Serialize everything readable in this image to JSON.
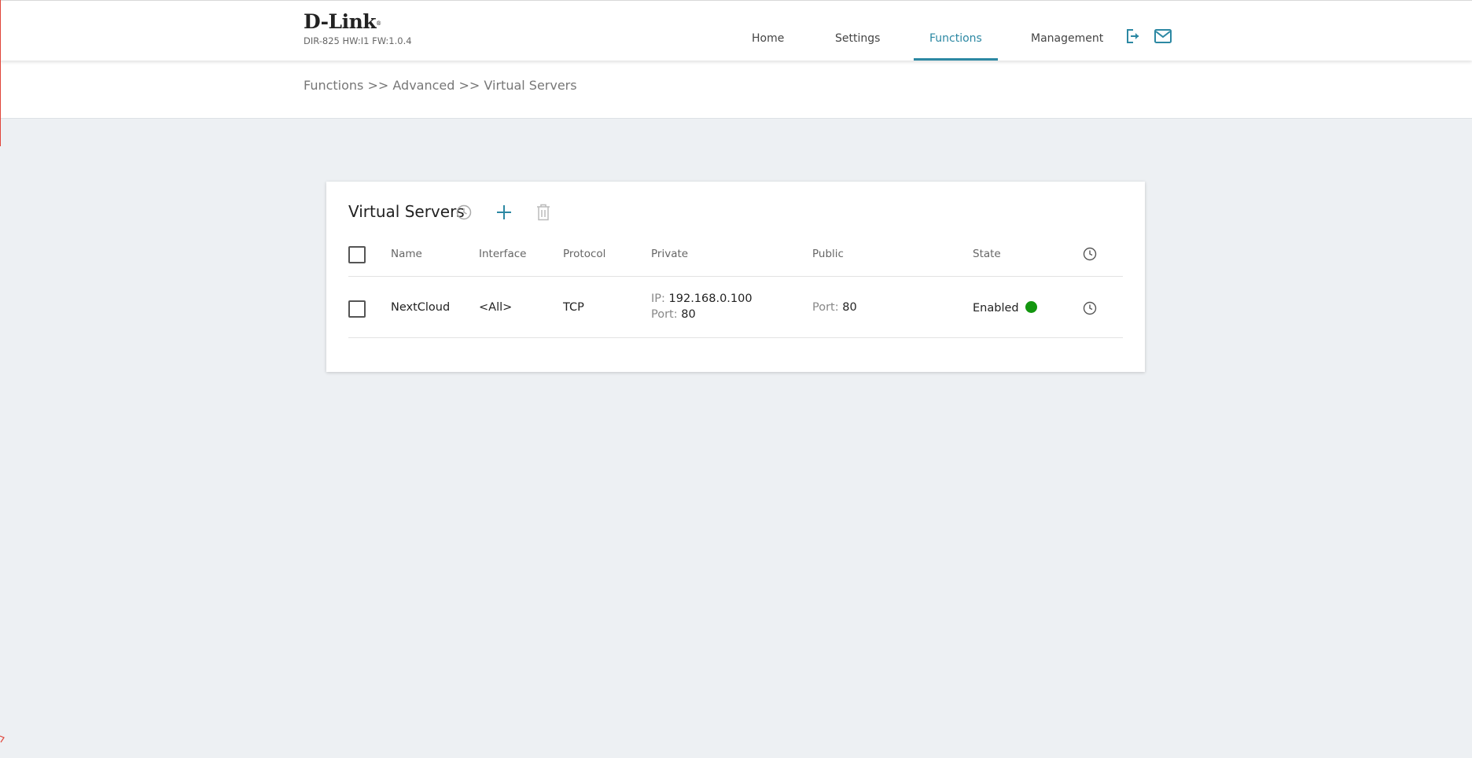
{
  "header": {
    "logo": "D-Link",
    "logo_mark": "®",
    "model": "DIR-825 HW:I1 FW:1.0.4",
    "nav": [
      {
        "label": "Home"
      },
      {
        "label": "Settings"
      },
      {
        "label": "Functions"
      },
      {
        "label": "Management"
      }
    ],
    "active_nav": "Functions",
    "icons": [
      "logout-icon",
      "mail-icon"
    ]
  },
  "breadcrumb": {
    "items": [
      "Functions",
      "Advanced",
      "Virtual Servers"
    ],
    "separator": ">>"
  },
  "panel": {
    "title": "Virtual Servers",
    "toolbar_icons": [
      "clock-icon",
      "plus-icon",
      "trash-icon"
    ],
    "columns": {
      "name": "Name",
      "interface": "Interface",
      "protocol": "Protocol",
      "private": "Private",
      "public": "Public",
      "state": "State"
    },
    "rows": [
      {
        "name": "NextCloud",
        "interface": "<All>",
        "protocol": "TCP",
        "private_ip_label": "IP:",
        "private_ip": "192.168.0.100",
        "private_port_label": "Port:",
        "private_port": "80",
        "public_port_label": "Port:",
        "public_port": "80",
        "state": "Enabled",
        "state_color": "#13960f"
      }
    ]
  },
  "colors": {
    "accent": "#2c88a3",
    "background": "#edf0f3",
    "enabled": "#13960f"
  }
}
